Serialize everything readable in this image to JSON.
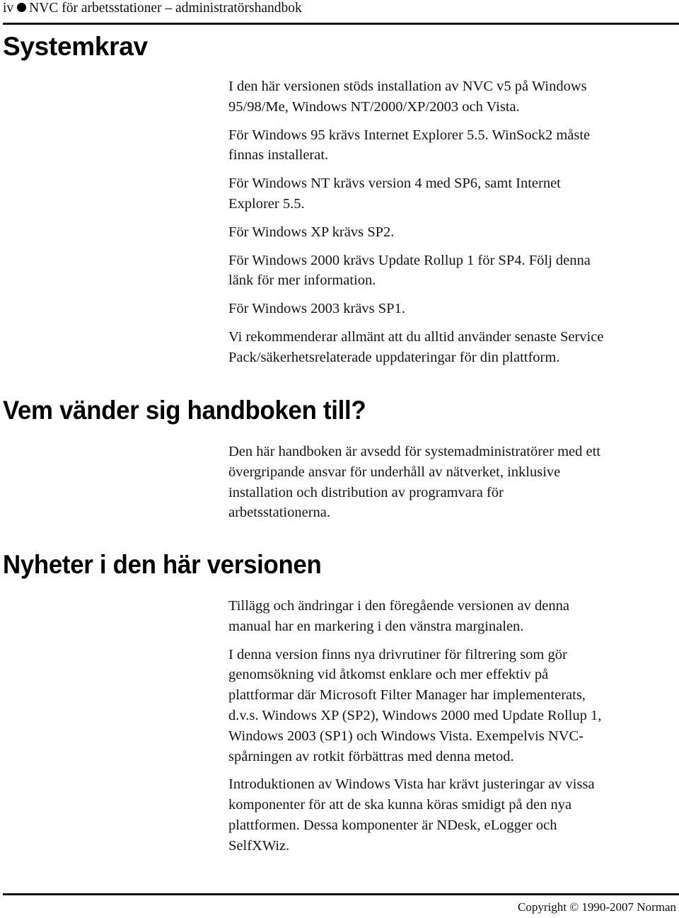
{
  "header": {
    "page_number": "iv",
    "bullet_icon": "filled-circle",
    "title": "NVC för arbetsstationer – administratörshandbok"
  },
  "sections": [
    {
      "heading": "Systemkrav",
      "paragraphs": [
        "I den här versionen stöds installation av NVC v5 på Windows\n95/98/Me, Windows NT/2000/XP/2003 och Vista.",
        "För Windows 95 krävs Internet Explorer 5.5. WinSock2 måste\nfinnas installerat.",
        "För Windows NT krävs version 4 med SP6, samt Internet\nExplorer 5.5.",
        "För Windows XP krävs SP2.",
        "För Windows 2000 krävs Update Rollup 1 för SP4. Följ denna\nlänk för mer information.",
        "För Windows 2003 krävs SP1.",
        "Vi rekommenderar allmänt att du alltid använder senaste Service\nPack/säkerhetsrelaterade uppdateringar för din plattform."
      ]
    },
    {
      "heading": "Vem vänder sig handboken till?",
      "paragraphs": [
        "Den här handboken är avsedd för systemadministratörer med ett\növergripande ansvar för underhåll av nätverket, inklusive\ninstallation och distribution av programvara för\narbetsstationerna."
      ]
    },
    {
      "heading": "Nyheter i den här versionen",
      "paragraphs": [
        "Tillägg och ändringar i den föregående versionen av denna\nmanual har en markering i den vänstra marginalen.",
        "I denna version finns nya drivrutiner för filtrering som gör\ngenomsökning vid åtkomst enklare och mer effektiv på\nplattformar där Microsoft Filter Manager har implementerats,\nd.v.s. Windows XP (SP2), Windows 2000 med Update Rollup 1,\nWindows 2003 (SP1) och Windows Vista. Exempelvis NVC-\nspårningen av rotkit förbättras med denna metod.",
        "Introduktionen av Windows Vista har krävt justeringar av vissa\nkomponenter för att de ska kunna köras smidigt på den nya\nplattformen. Dessa komponenter är NDesk, eLogger och\nSelfXWiz."
      ]
    }
  ],
  "footer": {
    "copyright": "Copyright © 1990-2007 Norman"
  }
}
